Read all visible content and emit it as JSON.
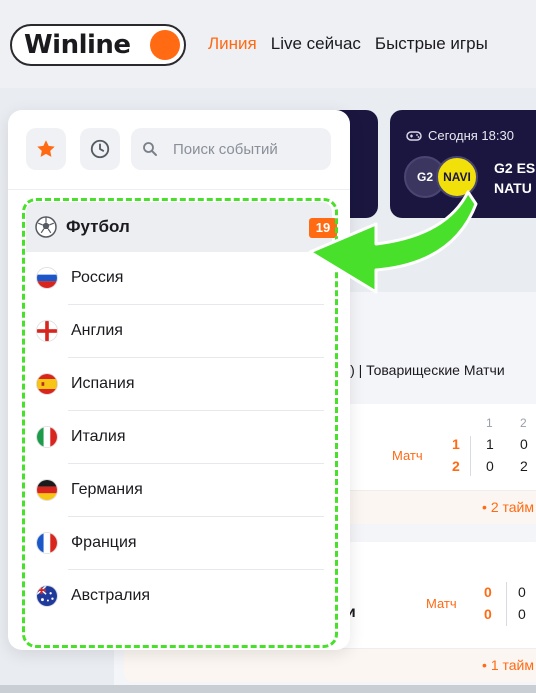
{
  "header": {
    "logo_text": "Winline",
    "nav": [
      {
        "label": "Линия",
        "active": true
      },
      {
        "label": "Live сейчас",
        "active": false
      },
      {
        "label": "Быстрые игры",
        "active": false
      }
    ]
  },
  "featured": {
    "time": "Сегодня 18:30",
    "team1_logo": "G2",
    "team2_logo": "NAVI",
    "team1": "G2 ES",
    "team2": "NATU"
  },
  "content": {
    "tournament": "ы) | Товарищеские Матчи",
    "events": [
      {
        "market_label": "Матч",
        "period_headers": [
          "1",
          "2"
        ],
        "scores": [
          {
            "total": "1",
            "p1": "1",
            "p2": "0"
          },
          {
            "total": "2",
            "p1": "0",
            "p2": "2"
          }
        ],
        "status": "• 2 тайм"
      },
      {
        "name_fragment": "ми",
        "market_label": "Матч",
        "scores": [
          {
            "total": "0",
            "p1": "0"
          },
          {
            "total": "0",
            "p1": "0"
          }
        ],
        "status": "• 1 тайм"
      }
    ]
  },
  "sidebar": {
    "search_placeholder": "Поиск событий",
    "sport": {
      "label": "Футбол",
      "count": "19"
    },
    "countries": [
      {
        "name": "Россия",
        "flag": "russia-flag"
      },
      {
        "name": "Англия",
        "flag": "england-flag"
      },
      {
        "name": "Испания",
        "flag": "spain-flag"
      },
      {
        "name": "Италия",
        "flag": "italy-flag"
      },
      {
        "name": "Германия",
        "flag": "germany-flag"
      },
      {
        "name": "Франция",
        "flag": "france-flag"
      },
      {
        "name": "Австралия",
        "flag": "australia-flag"
      }
    ]
  },
  "colors": {
    "accent": "#ff6a13",
    "highlight": "#49e02b",
    "dark_card": "#1a1640"
  }
}
